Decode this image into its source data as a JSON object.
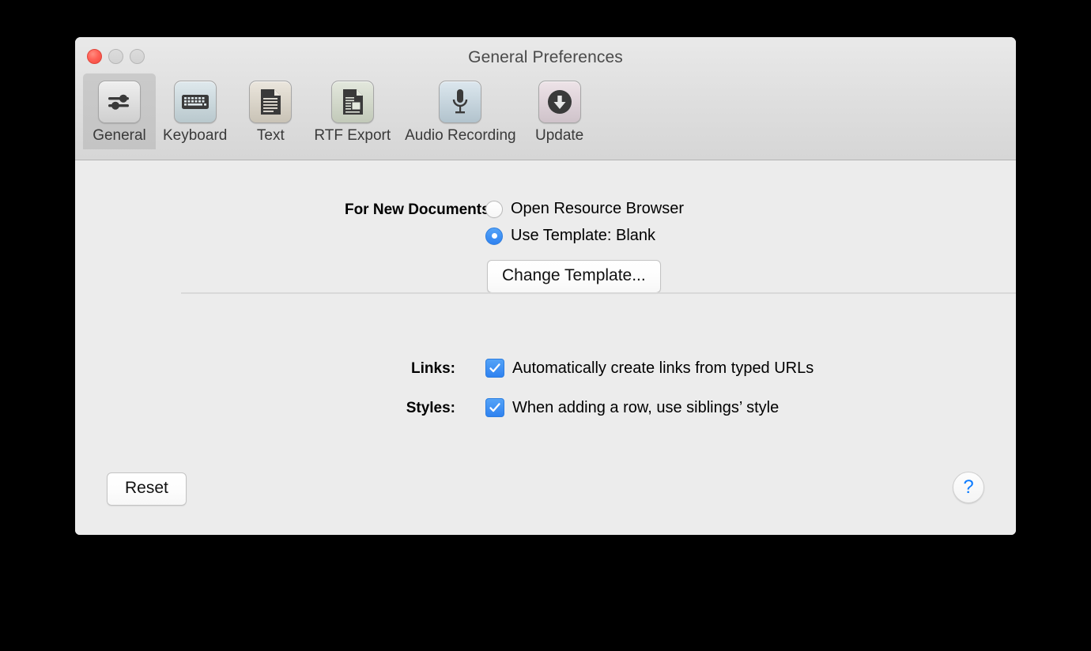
{
  "window": {
    "title": "General Preferences",
    "controls": [
      {
        "name": "close",
        "color": "#ff6157"
      },
      {
        "name": "minimize",
        "color": "#d6d6d6"
      },
      {
        "name": "zoom",
        "color": "#d6d6d6"
      }
    ]
  },
  "toolbar": {
    "selected": "General",
    "items": [
      {
        "label": "General",
        "icon": "sliders-icon",
        "selected": true
      },
      {
        "label": "Keyboard",
        "icon": "keyboard-icon",
        "selected": false
      },
      {
        "label": "Text",
        "icon": "document-icon",
        "selected": false
      },
      {
        "label": "RTF Export",
        "icon": "document-export-icon",
        "selected": false
      },
      {
        "label": "Audio Recording",
        "icon": "microphone-icon",
        "selected": false
      },
      {
        "label": "Update",
        "icon": "download-arrow-icon",
        "selected": false
      }
    ]
  },
  "main": {
    "new_documents": {
      "label": "For New Documents:",
      "options": [
        {
          "text": "Open Resource Browser",
          "selected": false
        },
        {
          "text": "Use Template: Blank",
          "selected": true
        }
      ],
      "change_template_button": "Change Template..."
    },
    "links": {
      "label": "Links:",
      "checkbox_text": "Automatically create links from typed URLs",
      "checked": true
    },
    "styles": {
      "label": "Styles:",
      "checkbox_text": "When adding a row, use siblings’ style",
      "checked": true
    },
    "reset_button": "Reset",
    "help_button": "?"
  },
  "colors": {
    "accent": "#2f82f0",
    "window_bg": "#ececec",
    "toolbar_bg": "#dedede",
    "help_glyph": "#0b7bff"
  }
}
